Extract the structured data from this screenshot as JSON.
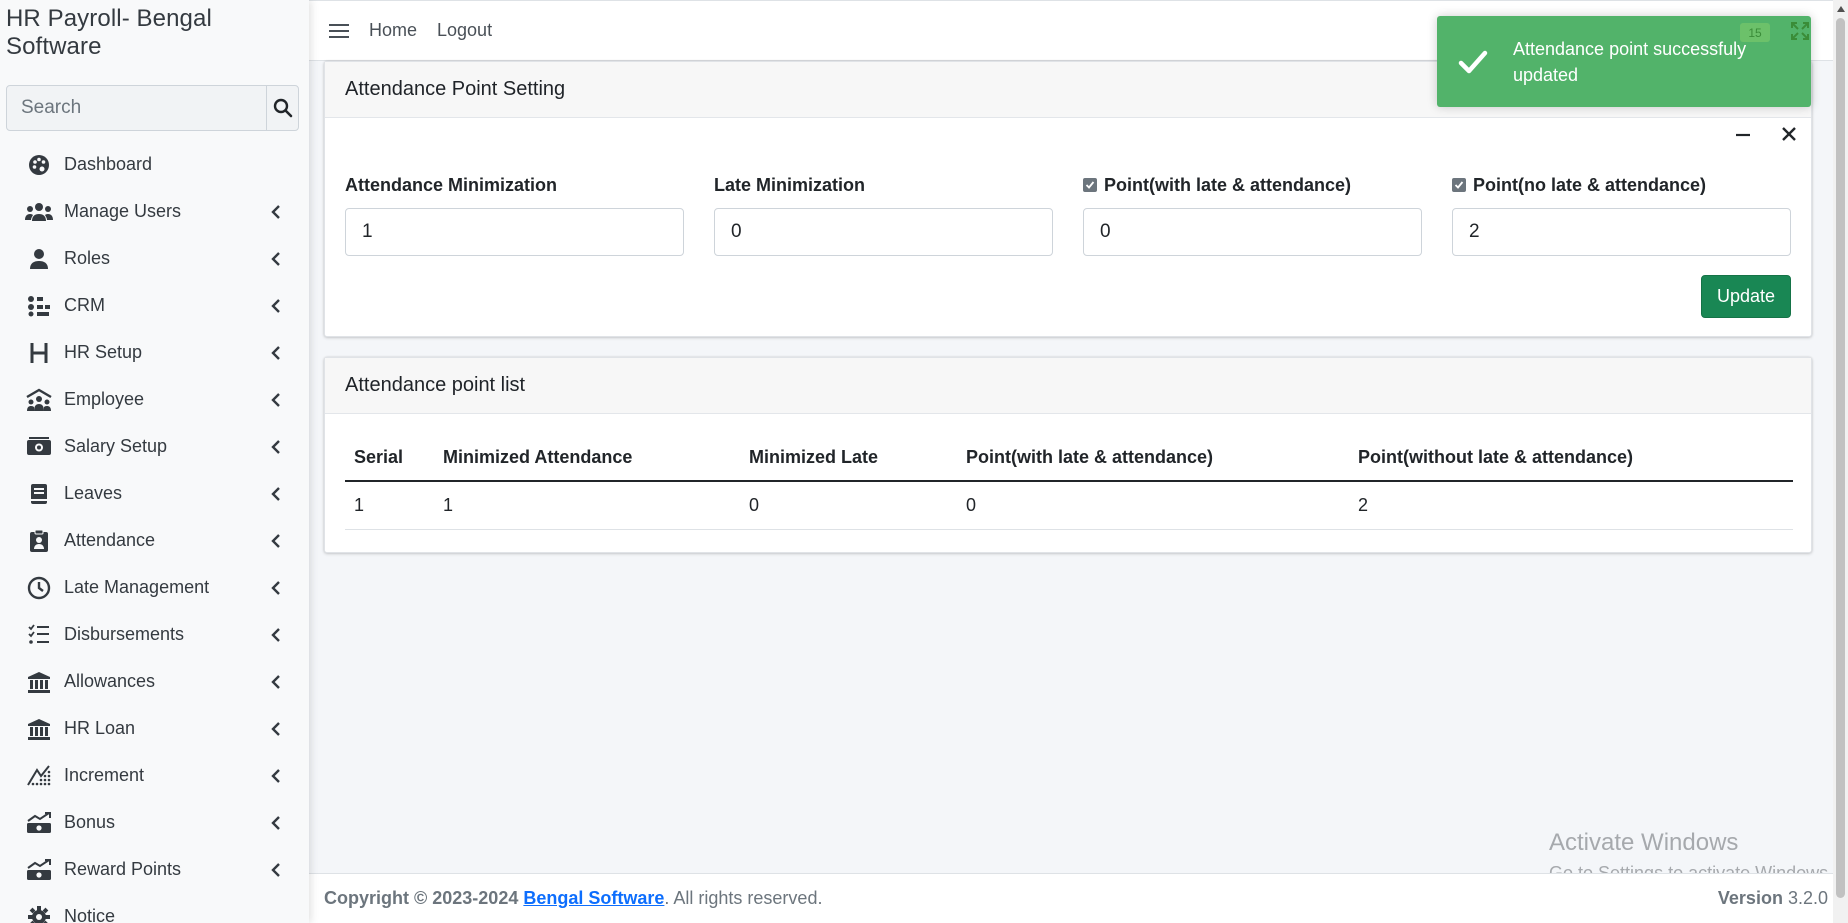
{
  "app": {
    "title": "HR Payroll- Bengal Software"
  },
  "search": {
    "placeholder": "Search"
  },
  "sidebar": {
    "items": [
      {
        "label": "Dashboard",
        "icon": "palette-icon"
      },
      {
        "label": "Manage Users",
        "icon": "users-icon"
      },
      {
        "label": "Roles",
        "icon": "user-icon"
      },
      {
        "label": "CRM",
        "icon": "crm-icon"
      },
      {
        "label": "HR Setup",
        "icon": "h-icon"
      },
      {
        "label": "Employee",
        "icon": "people-roof-icon"
      },
      {
        "label": "Salary Setup",
        "icon": "money-icon"
      },
      {
        "label": "Leaves",
        "icon": "book-icon"
      },
      {
        "label": "Attendance",
        "icon": "clipboard-user-icon"
      },
      {
        "label": "Late Management",
        "icon": "clock-icon"
      },
      {
        "label": "Disbursements",
        "icon": "list-check-icon"
      },
      {
        "label": "Allowances",
        "icon": "bank-icon"
      },
      {
        "label": "HR Loan",
        "icon": "bank-icon"
      },
      {
        "label": "Increment",
        "icon": "chart-dots-icon"
      },
      {
        "label": "Bonus",
        "icon": "money-bill-trend-icon"
      },
      {
        "label": "Reward Points",
        "icon": "money-bill-trend-icon"
      },
      {
        "label": "Notice",
        "icon": "gear-icon"
      }
    ]
  },
  "topbar": {
    "home": "Home",
    "logout": "Logout"
  },
  "setting_card": {
    "title": "Attendance Point Setting",
    "fields": [
      {
        "label": "Attendance Minimization",
        "value": "1",
        "checkbox": false
      },
      {
        "label": "Late Minimization",
        "value": "0",
        "checkbox": false
      },
      {
        "label": "Point(with late & attendance)",
        "value": "0",
        "checkbox": true
      },
      {
        "label": "Point(no late & attendance)",
        "value": "2",
        "checkbox": true
      }
    ],
    "update_label": "Update"
  },
  "list_card": {
    "title": "Attendance point list",
    "columns": [
      "Serial",
      "Minimized Attendance",
      "Minimized Late",
      "Point(with late & attendance)",
      "Point(without late & attendance)"
    ],
    "rows": [
      [
        "1",
        "1",
        "0",
        "0",
        "2"
      ]
    ]
  },
  "footer": {
    "copyright": "Copyright © 2023-2024",
    "company": "Bengal Software",
    "rights": ". All rights reserved.",
    "version_label": "Version",
    "version": "3.2.0"
  },
  "watermark": {
    "line1": "Activate Windows",
    "line2": "Go to Settings to activate Windows."
  },
  "toast": {
    "message": "Attendance point successfuly updated",
    "badge": "15",
    "color": "#52b36a"
  },
  "colors": {
    "accent": "#198754",
    "link": "#0d6efd"
  }
}
